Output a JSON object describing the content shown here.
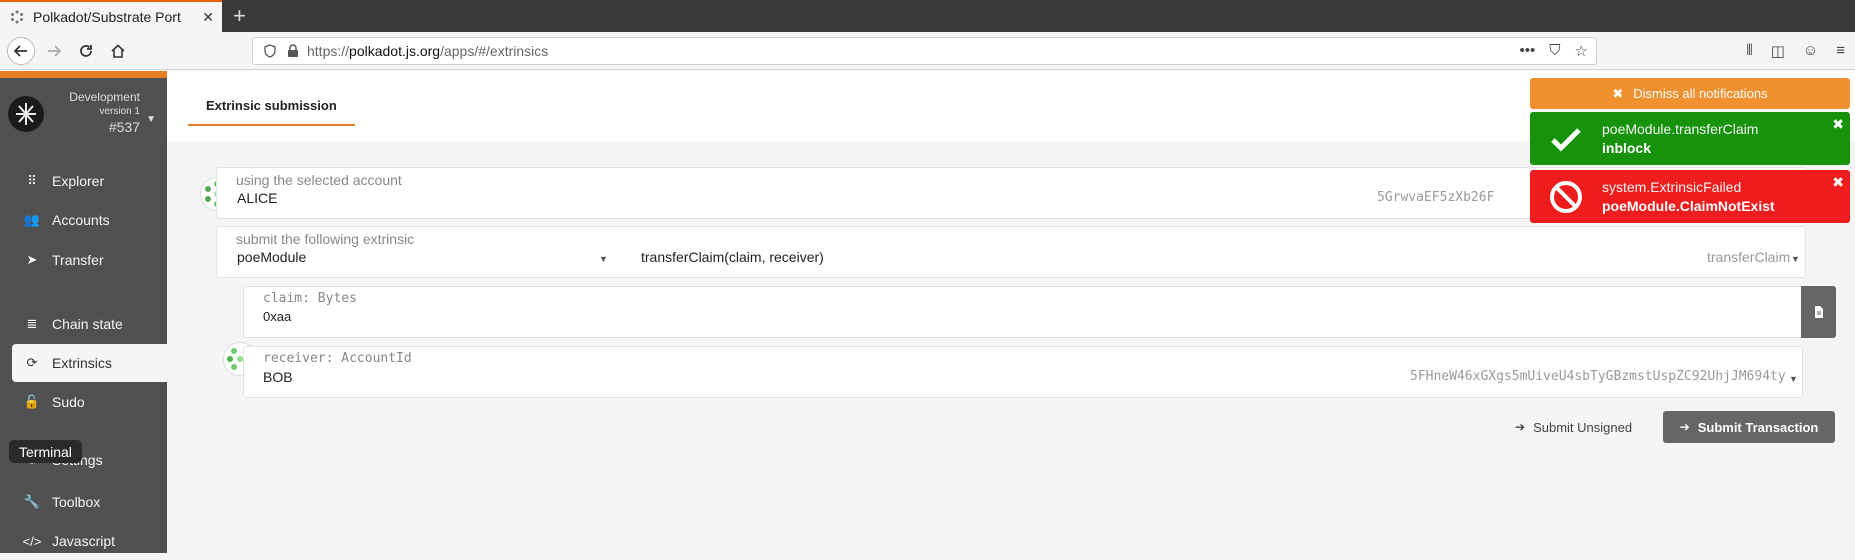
{
  "browser": {
    "tab_title": "Polkadot/Substrate Port",
    "tab_close": "✕",
    "new_tab": "+",
    "url_prefix": "https://",
    "url_host": "polkadot.js.org",
    "url_path": "/apps/#/extrinsics",
    "url_actions": [
      "•••",
      "⛉",
      "☆"
    ],
    "toolbar_icons": [
      "⫴",
      "◫",
      "☺",
      "≡"
    ]
  },
  "chain": {
    "name": "Development",
    "version": "version 1",
    "block": "#537"
  },
  "sidebar": {
    "items": [
      {
        "label": "Explorer",
        "icon": "explorer-icon",
        "glyph": "⠿"
      },
      {
        "label": "Accounts",
        "icon": "users-icon",
        "glyph": "👥"
      },
      {
        "label": "Transfer",
        "icon": "send-icon",
        "glyph": "➤"
      },
      {
        "label": "Chain state",
        "icon": "database-icon",
        "glyph": "≣"
      },
      {
        "label": "Extrinsics",
        "icon": "sync-icon",
        "glyph": "⟳"
      },
      {
        "label": "Sudo",
        "icon": "unlock-icon",
        "glyph": "🔓"
      },
      {
        "label": "Settings",
        "icon": "settings-icon",
        "glyph": "⚙"
      },
      {
        "label": "Toolbox",
        "icon": "wrench-icon",
        "glyph": "🔧"
      },
      {
        "label": "Javascript",
        "icon": "code-icon",
        "glyph": "</>"
      }
    ],
    "tooltip": "Terminal"
  },
  "page": {
    "tab": "Extrinsic submission"
  },
  "account": {
    "label": "using the selected account",
    "name": "ALICE",
    "address": "5GrwvaEF5zXb26F"
  },
  "extrinsic": {
    "label": "submit the following extrinsic",
    "module": "poeModule",
    "call": "transferClaim(claim, receiver)",
    "call_short": "transferClaim"
  },
  "claim": {
    "label": "claim: Bytes",
    "value": "0xaa"
  },
  "receiver": {
    "label": "receiver: AccountId",
    "name": "BOB",
    "address": "5FHneW46xGXgs5mUiveU4sbTyGBzmstUspZC92UhjJM694ty"
  },
  "actions": {
    "unsigned": "Submit Unsigned",
    "submit": "Submit Transaction"
  },
  "notifications": {
    "dismiss": "Dismiss all notifications",
    "items": [
      {
        "title": "poeModule.transferClaim",
        "status": "inblock",
        "type": "success",
        "color": "#16920b"
      },
      {
        "title": "system.ExtrinsicFailed",
        "status": "poeModule.ClaimNotExist",
        "type": "error",
        "color": "#ee1c1c"
      }
    ]
  },
  "colors": {
    "accent": "#e67f22",
    "sidebar": "#505050",
    "button": "#666666"
  }
}
